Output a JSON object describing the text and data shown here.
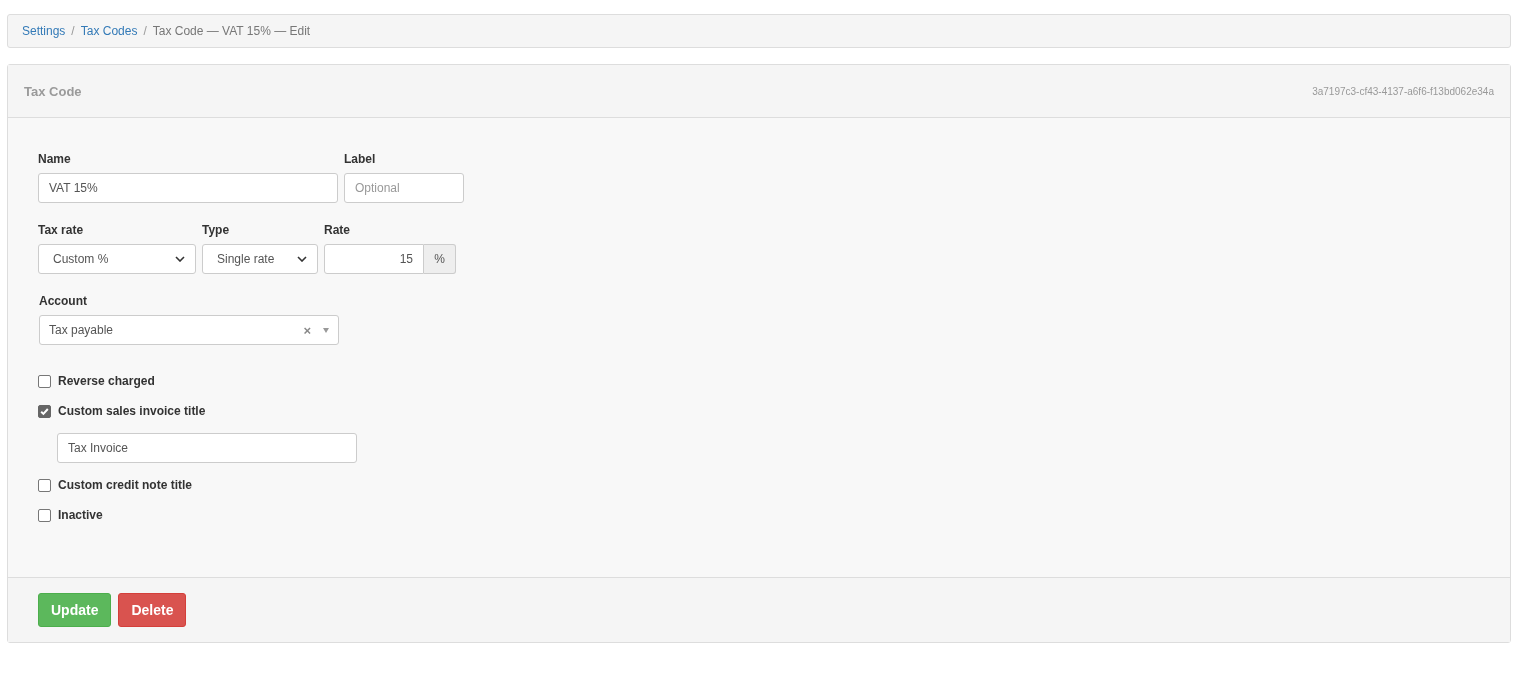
{
  "breadcrumb_separator": "/",
  "breadcrumb": [
    {
      "label": "Settings",
      "link": true
    },
    {
      "label": "Tax Codes",
      "link": true
    },
    {
      "label": "Tax Code — VAT 15% — Edit",
      "link": false
    }
  ],
  "panel": {
    "title": "Tax Code",
    "id_text": "3a7197c3-cf43-4137-a6f6-f13bd062e34a"
  },
  "name_field": {
    "label": "Name",
    "value": "VAT 15%"
  },
  "label_field": {
    "label": "Label",
    "placeholder": "Optional"
  },
  "tax_rate": {
    "label": "Tax rate",
    "value": "Custom %"
  },
  "type": {
    "label": "Type",
    "value": "Single rate"
  },
  "rate": {
    "label": "Rate",
    "value": "15",
    "unit": "%"
  },
  "account": {
    "label": "Account",
    "value": "Tax payable",
    "clear": "×"
  },
  "options": [
    {
      "label": "Reverse charged",
      "checked": false
    },
    {
      "label": "Custom sales invoice title",
      "checked": true,
      "title_value": "Tax Invoice"
    },
    {
      "label": "Custom credit note title",
      "checked": false
    },
    {
      "label": "Inactive",
      "checked": false
    }
  ],
  "buttons": [
    {
      "label": "Update",
      "kind": "primary"
    },
    {
      "label": "Delete",
      "kind": "danger"
    }
  ]
}
